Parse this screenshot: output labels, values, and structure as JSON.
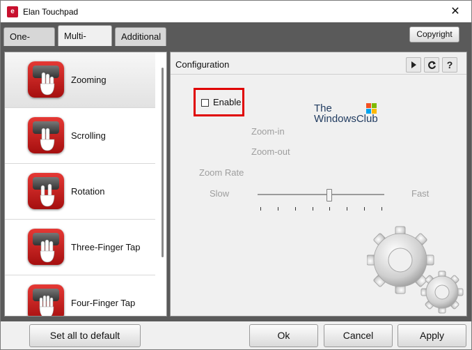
{
  "window": {
    "title": "Elan Touchpad",
    "app_icon": "elan-logo-icon",
    "close_glyph": "✕"
  },
  "tabs": [
    {
      "label": "One-finger",
      "active": false
    },
    {
      "label": "Multi-finger",
      "active": true
    },
    {
      "label": "Additional",
      "active": false
    }
  ],
  "copyright_label": "Copyright",
  "gestures": [
    {
      "label": "Zooming",
      "icon": "zoom-gesture-icon",
      "selected": true
    },
    {
      "label": "Scrolling",
      "icon": "scroll-gesture-icon",
      "selected": false
    },
    {
      "label": "Rotation",
      "icon": "rotation-gesture-icon",
      "selected": false
    },
    {
      "label": "Three-Finger Tap",
      "icon": "three-finger-tap-icon",
      "selected": false
    },
    {
      "label": "Four-Finger Tap",
      "icon": "four-finger-tap-icon",
      "selected": false
    }
  ],
  "config": {
    "title": "Configuration",
    "play_icon": "play-icon",
    "refresh_icon": "refresh-icon",
    "help_label": "?",
    "enable_label": "Enable",
    "enable_checked": false,
    "zoom_in_label": "Zoom-in",
    "zoom_out_label": "Zoom-out",
    "zoom_rate_label": "Zoom Rate",
    "slow_label": "Slow",
    "fast_label": "Fast",
    "zoom_rate_value": 0.57,
    "tick_count": 8
  },
  "watermark": {
    "line1": "The",
    "line2": "WindowsClub"
  },
  "footer": {
    "default_label": "Set all to default",
    "ok_label": "Ok",
    "cancel_label": "Cancel",
    "apply_label": "Apply"
  },
  "colors": {
    "accent_red": "#e00000",
    "tabstrip_bg": "#5a5a5a"
  }
}
